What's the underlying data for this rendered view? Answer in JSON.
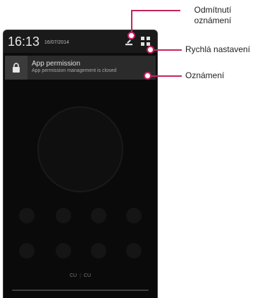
{
  "status_bar": {
    "time": "16:13",
    "date": "16/07/2014"
  },
  "notification": {
    "title": "App permission",
    "text": "App permission management is closed",
    "icon": "lock-icon"
  },
  "carrier": {
    "left": "CU",
    "right": "CU"
  },
  "callouts": {
    "dismiss_line1": "Odmítnutí",
    "dismiss_line2": "oznámení",
    "quick_settings": "Rychlá nastavení",
    "notifications": "Oznámení"
  },
  "colors": {
    "accent": "#c4245f",
    "panel_bg": "#1a1a1a",
    "notification_bg": "#2b2b2b"
  }
}
